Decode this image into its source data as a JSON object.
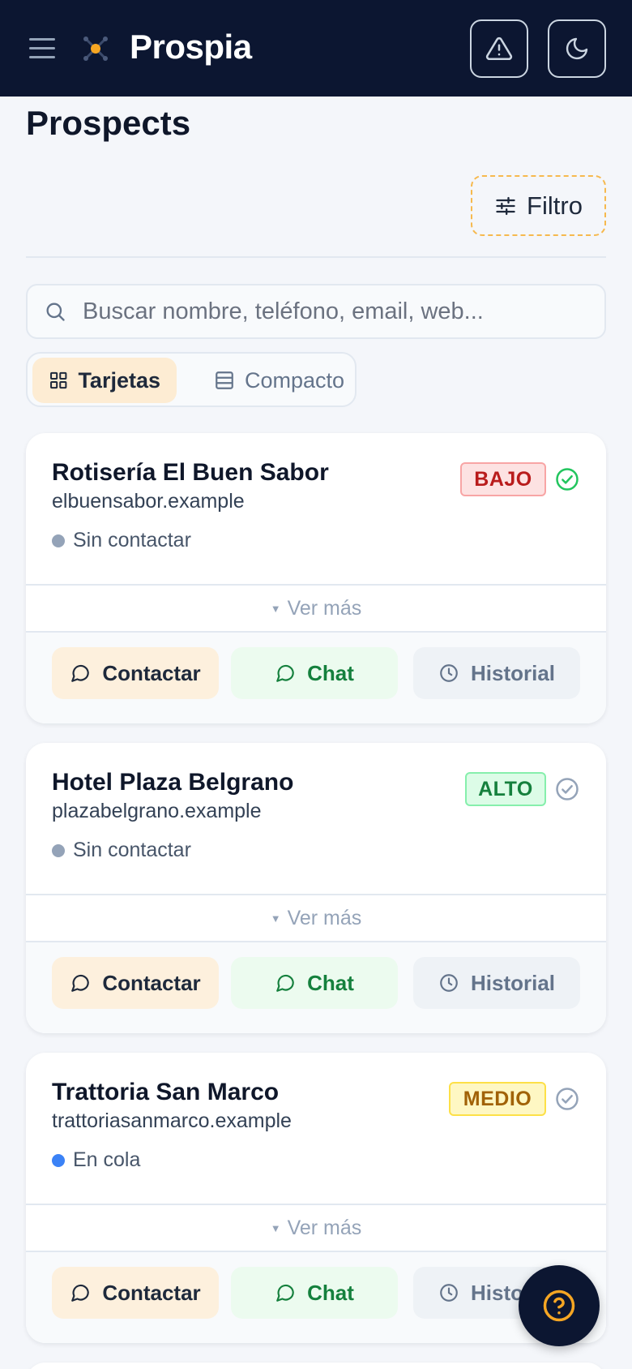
{
  "app": {
    "brand": "Prospia"
  },
  "page": {
    "title": "Prospects"
  },
  "toolbar": {
    "filter_label": "Filtro"
  },
  "search": {
    "placeholder": "Buscar nombre, teléfono, email, web..."
  },
  "view_toggle": {
    "cards_label": "Tarjetas",
    "compact_label": "Compacto",
    "selected": "Tarjetas"
  },
  "colors": {
    "topbar": "#0c1631",
    "accent": "#f6a623",
    "badge_bajo": "#b91c1c",
    "badge_alto": "#15803d",
    "badge_medio": "#a16207",
    "status_gray": "#94a3b8",
    "status_blue": "#3b82f6"
  },
  "prospects": [
    {
      "name": "Rotisería El Buen Sabor",
      "domain": "elbuensabor.example",
      "status": "Sin contactar",
      "status_color": "gray",
      "priority": "BAJO",
      "verified": true,
      "more_label": "Ver más",
      "actions": {
        "contact": "Contactar",
        "chat": "Chat",
        "history": "Historial"
      }
    },
    {
      "name": "Hotel Plaza Belgrano",
      "domain": "plazabelgrano.example",
      "status": "Sin contactar",
      "status_color": "gray",
      "priority": "ALTO",
      "verified": false,
      "more_label": "Ver más",
      "actions": {
        "contact": "Contactar",
        "chat": "Chat",
        "history": "Historial"
      }
    },
    {
      "name": "Trattoria San Marco",
      "domain": "trattoriasanmarco.example",
      "status": "En cola",
      "status_color": "blue",
      "priority": "MEDIO",
      "verified": false,
      "more_label": "Ver más",
      "actions": {
        "contact": "Contactar",
        "chat": "Chat",
        "history": "Historial"
      }
    }
  ]
}
